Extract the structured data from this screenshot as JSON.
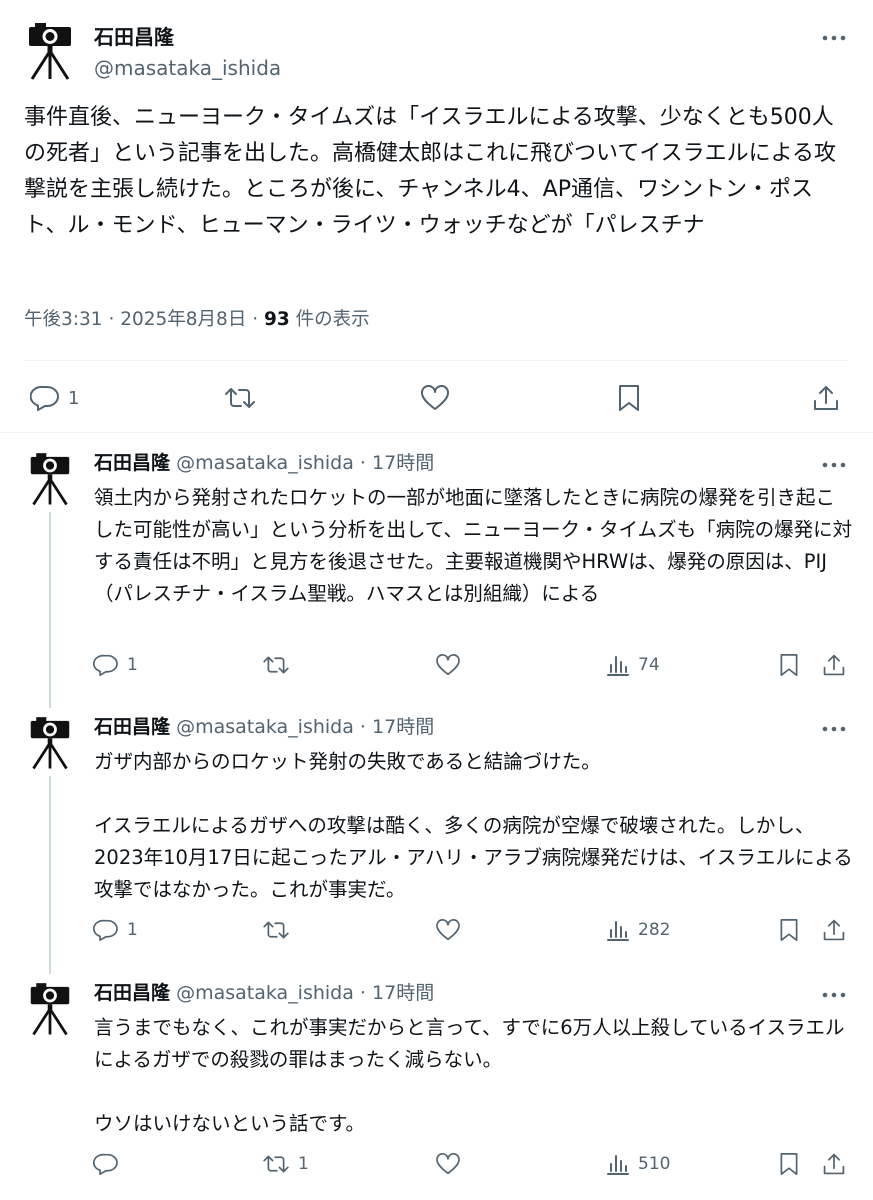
{
  "colors": {
    "text": "#0f1419",
    "secondary": "#536471",
    "divider": "#eff3f4",
    "thread": "#cfd9de"
  },
  "main_tweet": {
    "author_name": "石田昌隆",
    "author_handle": "@masataka_ishida",
    "avatar_icon": "camera-tripod-icon",
    "text": "事件直後、ニューヨーク・タイムズは「イスラエルによる攻撃、少なくとも500人の死者」という記事を出した。高橋健太郎はこれに飛びついてイスラエルによる攻撃説を主張し続けた。ところが後に、チャンネル4、AP通信、ワシントン・ポスト、ル・モンド、ヒューマン・ライツ・ウォッチなどが「パレスチナ",
    "time": "午後3:31",
    "date": "2025年8月8日",
    "views_count": "93",
    "views_label": "件の表示",
    "replies": "1"
  },
  "replies": [
    {
      "author_name": "石田昌隆",
      "author_handle": "@masataka_ishida",
      "time": "17時間",
      "text": "領土内から発射されたロケットの一部が地面に墜落したときに病院の爆発を引き起こした可能性が高い」という分析を出して、ニューヨーク・タイムズも「病院の爆発に対する責任は不明」と見方を後退させた。主要報道機関やHRWは、爆発の原因は、PIJ（パレスチナ・イスラム聖戦。ハマスとは別組織）による",
      "replies": "1",
      "reposts": "",
      "views": "74"
    },
    {
      "author_name": "石田昌隆",
      "author_handle": "@masataka_ishida",
      "time": "17時間",
      "text": "ガザ内部からのロケット発射の失敗であると結論づけた。\n\nイスラエルによるガザへの攻撃は酷く、多くの病院が空爆で破壊された。しかし、2023年10月17日に起こったアル・アハリ・アラブ病院爆発だけは、イスラエルによる攻撃ではなかった。これが事実だ。",
      "replies": "1",
      "reposts": "",
      "views": "282"
    },
    {
      "author_name": "石田昌隆",
      "author_handle": "@masataka_ishida",
      "time": "17時間",
      "text": "言うまでもなく、これが事実だからと言って、すでに6万人以上殺しているイスラエルによるガザでの殺戮の罪はまったく減らない。\n\nウソはいけないという話です。",
      "replies": "",
      "reposts": "1",
      "views": "510"
    }
  ]
}
